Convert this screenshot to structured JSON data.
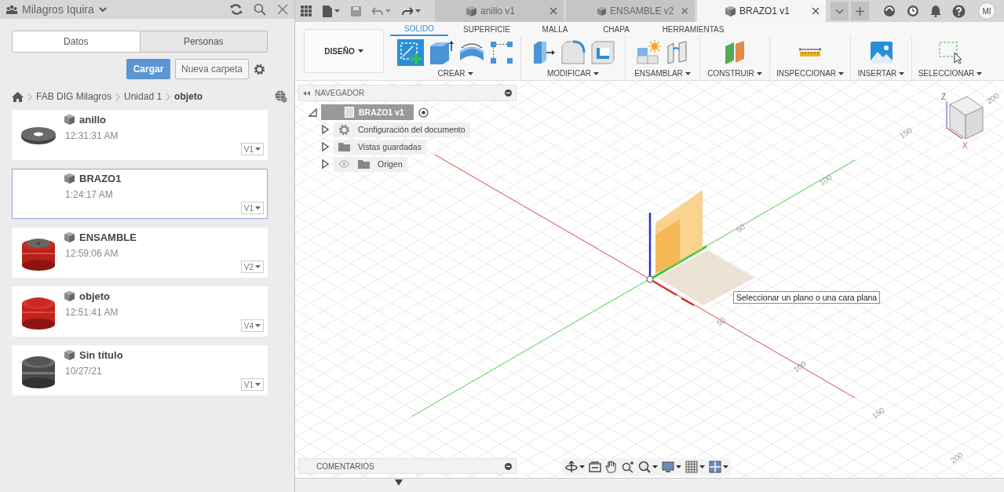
{
  "data_panel": {
    "user": "Milagros Iquira",
    "tabs": [
      {
        "label": "Datos",
        "selected": true
      },
      {
        "label": "Personas",
        "selected": false
      }
    ],
    "upload_button": "Cargar",
    "new_folder_button": "Nueva carpeta",
    "breadcrumb": [
      "FAB DIG Milagros",
      "Unidad 1",
      "objeto"
    ],
    "files": [
      {
        "name": "anillo",
        "time": "12:31:31 AM",
        "version": "V1",
        "selected": false,
        "kind": "washer"
      },
      {
        "name": "BRAZO1",
        "time": "1:24:17 AM",
        "version": "V1",
        "selected": true,
        "kind": "none"
      },
      {
        "name": "ENSAMBLE",
        "time": "12:59:06 AM",
        "version": "V2",
        "selected": false,
        "kind": "red-capped"
      },
      {
        "name": "objeto",
        "time": "12:51:41 AM",
        "version": "V4",
        "selected": false,
        "kind": "red"
      },
      {
        "name": "Sin título",
        "time": "10/27/21",
        "version": "V1",
        "selected": false,
        "kind": "grey"
      }
    ]
  },
  "document_tabs": [
    {
      "label": "anillo v1",
      "selected": false
    },
    {
      "label": "ENSAMBLE v2",
      "selected": false
    },
    {
      "label": "BRAZO1 v1",
      "selected": true
    }
  ],
  "avatar_initials": "MI",
  "ribbon": {
    "workspace": "DISEÑO",
    "tabs": [
      {
        "label": "SOLIDO",
        "selected": true
      },
      {
        "label": "SUPERFICIE",
        "selected": false
      },
      {
        "label": "MALLA",
        "selected": false
      },
      {
        "label": "CHAPA",
        "selected": false
      },
      {
        "label": "HERRAMIENTAS",
        "selected": false
      }
    ],
    "groups": [
      "CREAR",
      "MODIFICAR",
      "ENSAMBLAR",
      "CONSTRUIR",
      "INSPECCIONAR",
      "INSERTAR",
      "SELECCIONAR"
    ]
  },
  "navigator": {
    "title": "NAVEGADOR",
    "root": {
      "label": "BRAZO1 v1",
      "expanded": true,
      "children": [
        {
          "label": "Configuración del documento",
          "kind": "settings",
          "expanded": false
        },
        {
          "label": "Vistas guardadas",
          "kind": "folder",
          "expanded": false
        },
        {
          "label": "Origen",
          "kind": "origin",
          "expanded": false
        }
      ]
    }
  },
  "comments_title": "COMENTARIOS",
  "tooltip": "Seleccionar un plano o una cara plana",
  "view_cube": {
    "z_label": "Z",
    "x_label": "X"
  },
  "axis_labels": [
    "150",
    "100",
    "50",
    "50",
    "100",
    "150",
    "200",
    "200"
  ]
}
